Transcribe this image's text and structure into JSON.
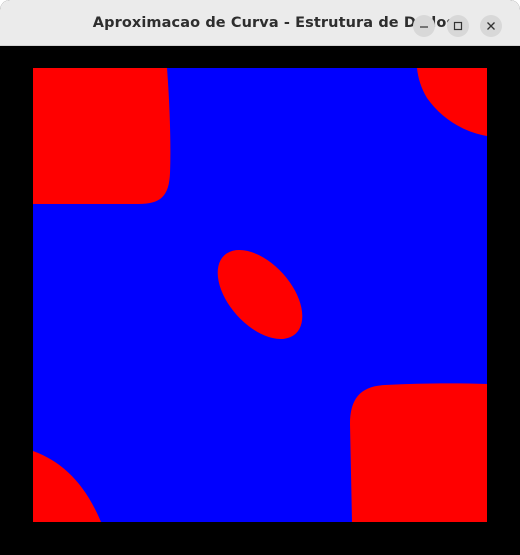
{
  "window": {
    "title": "Aproximacao de Curva - Estrutura de Dados",
    "controls": {
      "minimize_icon": "minimize-icon",
      "maximize_icon": "maximize-icon",
      "close_icon": "close-icon"
    }
  },
  "canvas": {
    "background_color": "#000000",
    "inside_color": "#0000ff",
    "outside_color": "#ff0000"
  }
}
